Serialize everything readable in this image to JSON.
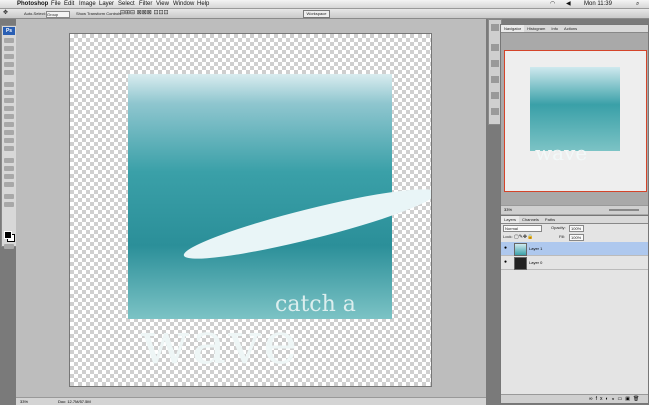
{
  "menubar": {
    "app": "Photoshop",
    "items": [
      "File",
      "Edit",
      "Image",
      "Layer",
      "Select",
      "Filter",
      "View",
      "Window",
      "Help"
    ],
    "clock": "Mon 11:39"
  },
  "options": {
    "auto_select": "Auto-Select:",
    "auto_select_value": "Group",
    "show_transform": "Show Transform Controls",
    "workspace": "Workspace"
  },
  "toolbox": {
    "logo": "Ps"
  },
  "canvas": {
    "catch_text": "catch a",
    "wave_text": "wave"
  },
  "status": {
    "zoom": "33%",
    "doc": "Doc: 12.7M/57.5M"
  },
  "navigator": {
    "tabs": [
      "Navigator",
      "Histogram",
      "Info",
      "Actions"
    ],
    "zoom": "33%"
  },
  "layers": {
    "tabs": [
      "Layers",
      "Channels",
      "Paths"
    ],
    "blend_mode": "Normal",
    "opacity_label": "Opacity:",
    "opacity_value": "100%",
    "lock_label": "Lock:",
    "fill_label": "Fill:",
    "fill_value": "100%",
    "rows": [
      {
        "name": "Layer 1",
        "selected": true
      },
      {
        "name": "Layer 0",
        "selected": false
      }
    ]
  },
  "colors": {
    "highlight": "#aec8ee",
    "proxy_border": "#d4442a",
    "ps_blue": "#2a5fb4"
  }
}
